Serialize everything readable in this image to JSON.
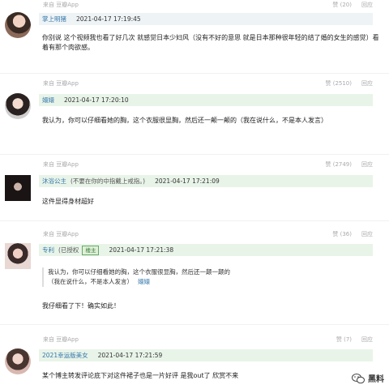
{
  "comments": [
    {
      "source": "来自 豆瓣App",
      "likes": "赞 (20)",
      "reply": "回应",
      "username": "掌上明猪",
      "time": "2021-04-17 17:19:45",
      "text": "你别说 这个视频我也看了好几次 就感觉日本少妇风（没有不好的意思 就是日本那种很年轻的结了婚的女生的感觉）看着有那个肉欲感。"
    },
    {
      "source": "来自 豆瓣App",
      "likes": "赞 (2510)",
      "reply": "回应",
      "username": "嬛嬛",
      "time": "2021-04-17 17:20:10",
      "text": "我认为，你可以仔细看她的胸，这个衣服很显胸，然后还一颠一颠的（我在说什么，不是本人发言）"
    },
    {
      "source": "来自 豆瓣App",
      "likes": "赞 (2749)",
      "reply": "回应",
      "username": "沐浴公主",
      "signature": "(不要在你的中指戴上戒指。)",
      "time": "2021-04-17 17:21:09",
      "text": "这件显得身材超好"
    },
    {
      "source": "来自 豆瓣App",
      "likes": "赞 (36)",
      "reply": "回应",
      "username": "专利",
      "signature": "(已授权",
      "badge": "楼主",
      "time": "2021-04-17 17:21:38",
      "quote_text": "我认为，你可以仔细看她的胸，这个衣服很显胸，然后还一颠一颠的",
      "quote_text2": "（我在说什么，不是本人发言）",
      "quote_author": "嬛嬛",
      "text": "我仔细看了下！确实如此！"
    },
    {
      "source": "来自 豆瓣App",
      "likes": "赞 (7)",
      "reply": "回应",
      "username": "2021幸运版美女",
      "time": "2021-04-17 17:21:59",
      "text": "某个博主转发评论底下对这件裙子也是一片好评 是我out了 欣赏不来"
    }
  ],
  "watermark": {
    "label": "黑料"
  },
  "colors": {
    "header_bg": "#e9f4e9",
    "username": "#3377aa"
  }
}
